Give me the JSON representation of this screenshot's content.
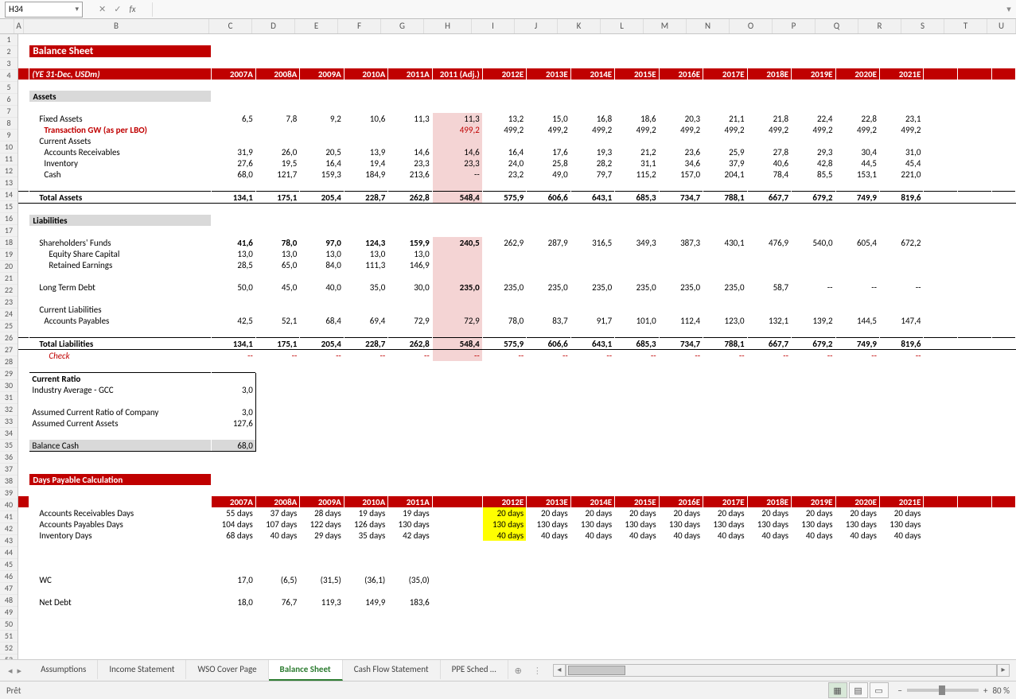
{
  "cellRef": "H34",
  "fxValue": "",
  "statusText": "Prêt",
  "zoomPct": "80 %",
  "cols": [
    "A",
    "B",
    "C",
    "D",
    "E",
    "F",
    "G",
    "H",
    "I",
    "J",
    "K",
    "L",
    "M",
    "N",
    "O",
    "P",
    "Q",
    "R",
    "S",
    "T",
    "U"
  ],
  "colWidths": {
    "A": 11,
    "B": 232,
    "C": 53,
    "D": 53,
    "E": 53,
    "F": 53,
    "G": 53,
    "H": 59,
    "I": 53,
    "J": 53,
    "K": 53,
    "L": 53,
    "M": 53,
    "N": 53,
    "O": 53,
    "P": 53,
    "Q": 53,
    "R": 53,
    "S": 53,
    "T": 53,
    "U": 35
  },
  "tabs": [
    "Assumptions",
    "Income Statement",
    "WSO Cover Page",
    "Balance Sheet",
    "Cash Flow Statement",
    "PPE Sched …"
  ],
  "activeTab": 3,
  "title": "Balance Sheet",
  "yearsLabel": "(YE 31-Dec, USDm)",
  "years": [
    "2007A",
    "2008A",
    "2009A",
    "2010A",
    "2011A",
    "2011 (Adj.)",
    "2012E",
    "2013E",
    "2014E",
    "2015E",
    "2016E",
    "2017E",
    "2018E",
    "2019E",
    "2020E",
    "2021E"
  ],
  "assetsHeader": "Assets",
  "liabHeader": "Liabilities",
  "dpHeader": "Days Payable Calculation",
  "rows": {
    "fixedAssets": {
      "label": "Fixed Assets",
      "v": [
        "6,5",
        "7,8",
        "9,2",
        "10,6",
        "11,3",
        "11,3",
        "13,2",
        "15,0",
        "16,8",
        "18,6",
        "20,3",
        "21,1",
        "21,8",
        "22,4",
        "22,8",
        "23,1"
      ]
    },
    "transGW": {
      "label": "Transaction GW (as per LBO)",
      "v": [
        "",
        "",
        "",
        "",
        "",
        "499,2",
        "499,2",
        "499,2",
        "499,2",
        "499,2",
        "499,2",
        "499,2",
        "499,2",
        "499,2",
        "499,2",
        "499,2"
      ]
    },
    "curAssetsLbl": "Current Assets",
    "ar": {
      "label": "Accounts Receivables",
      "v": [
        "31,9",
        "26,0",
        "20,5",
        "13,9",
        "14,6",
        "14,6",
        "16,4",
        "17,6",
        "19,3",
        "21,2",
        "23,6",
        "25,9",
        "27,8",
        "29,3",
        "30,4",
        "31,0"
      ]
    },
    "inv": {
      "label": "Inventory",
      "v": [
        "27,6",
        "19,5",
        "16,4",
        "19,4",
        "23,3",
        "23,3",
        "24,0",
        "25,8",
        "28,2",
        "31,1",
        "34,6",
        "37,9",
        "40,6",
        "42,8",
        "44,5",
        "45,4"
      ]
    },
    "cash": {
      "label": "Cash",
      "v": [
        "68,0",
        "121,7",
        "159,3",
        "184,9",
        "213,6",
        "--",
        "23,2",
        "49,0",
        "79,7",
        "115,2",
        "157,0",
        "204,1",
        "78,4",
        "85,5",
        "153,1",
        "221,0"
      ]
    },
    "totAssets": {
      "label": "Total Assets",
      "v": [
        "134,1",
        "175,1",
        "205,4",
        "228,7",
        "262,8",
        "548,4",
        "575,9",
        "606,6",
        "643,1",
        "685,3",
        "734,7",
        "788,1",
        "667,7",
        "679,2",
        "749,9",
        "819,6"
      ]
    },
    "shFunds": {
      "label": "Shareholders' Funds",
      "v": [
        "41,6",
        "78,0",
        "97,0",
        "124,3",
        "159,9",
        "240,5",
        "262,9",
        "287,9",
        "316,5",
        "349,3",
        "387,3",
        "430,1",
        "476,9",
        "540,0",
        "605,4",
        "672,2"
      ]
    },
    "esc": {
      "label": "Equity Share Capital",
      "v": [
        "13,0",
        "13,0",
        "13,0",
        "13,0",
        "13,0",
        "",
        "",
        "",
        "",
        "",
        "",
        "",
        "",
        "",
        "",
        ""
      ]
    },
    "re": {
      "label": "Retained Earnings",
      "v": [
        "28,5",
        "65,0",
        "84,0",
        "111,3",
        "146,9",
        "",
        "",
        "",
        "",
        "",
        "",
        "",
        "",
        "",
        "",
        ""
      ]
    },
    "ltd": {
      "label": "Long Term Debt",
      "v": [
        "50,0",
        "45,0",
        "40,0",
        "35,0",
        "30,0",
        "235,0",
        "235,0",
        "235,0",
        "235,0",
        "235,0",
        "235,0",
        "235,0",
        "58,7",
        "--",
        "--",
        "--"
      ]
    },
    "curLiabLbl": "Current Liabilities",
    "ap": {
      "label": "Accounts Payables",
      "v": [
        "42,5",
        "52,1",
        "68,4",
        "69,4",
        "72,9",
        "72,9",
        "78,0",
        "83,7",
        "91,7",
        "101,0",
        "112,4",
        "123,0",
        "132,1",
        "139,2",
        "144,5",
        "147,4"
      ]
    },
    "totLiab": {
      "label": "Total Liabilities",
      "v": [
        "134,1",
        "175,1",
        "205,4",
        "228,7",
        "262,8",
        "548,4",
        "575,9",
        "606,6",
        "643,1",
        "685,3",
        "734,7",
        "788,1",
        "667,7",
        "679,2",
        "749,9",
        "819,6"
      ]
    },
    "check": {
      "label": "Check",
      "v": [
        "--",
        "--",
        "--",
        "--",
        "--",
        "--",
        "--",
        "--",
        "--",
        "--",
        "--",
        "--",
        "--",
        "--",
        "--",
        "--"
      ]
    }
  },
  "crBox": {
    "title": "Current Ratio",
    "ind": {
      "label": "Industry Average - GCC",
      "v": "3,0"
    },
    "ass": {
      "label": "Assumed Current Ratio of Company",
      "v": "3,0"
    },
    "ca": {
      "label": "Assumed Current Assets",
      "v": "127,6"
    },
    "bal": {
      "label": "Balance Cash",
      "v": "68,0"
    }
  },
  "dp": {
    "yearsA": [
      "2007A",
      "2008A",
      "2009A",
      "2010A",
      "2011A"
    ],
    "yearsE": [
      "2012E",
      "2013E",
      "2014E",
      "2015E",
      "2016E",
      "2017E",
      "2018E",
      "2019E",
      "2020E",
      "2021E"
    ],
    "ard": {
      "label": "Accounts Receivables Days",
      "a": [
        "55 days",
        "37 days",
        "28 days",
        "19 days",
        "19 days"
      ],
      "e": [
        "20 days",
        "20 days",
        "20 days",
        "20 days",
        "20 days",
        "20 days",
        "20 days",
        "20 days",
        "20 days",
        "20 days"
      ]
    },
    "apd": {
      "label": "Accounts Payables Days",
      "a": [
        "104 days",
        "107 days",
        "122 days",
        "126 days",
        "130 days"
      ],
      "e": [
        "130 days",
        "130 days",
        "130 days",
        "130 days",
        "130 days",
        "130 days",
        "130 days",
        "130 days",
        "130 days",
        "130 days"
      ]
    },
    "invd": {
      "label": "Inventory Days",
      "a": [
        "68 days",
        "40 days",
        "29 days",
        "35 days",
        "42 days"
      ],
      "e": [
        "40 days",
        "40 days",
        "40 days",
        "40 days",
        "40 days",
        "40 days",
        "40 days",
        "40 days",
        "40 days",
        "40 days"
      ]
    }
  },
  "wc": {
    "label": "WC",
    "v": [
      "17,0",
      "(6,5)",
      "(31,5)",
      "(36,1)",
      "(35,0)"
    ]
  },
  "nd": {
    "label": "Net Debt",
    "v": [
      "18,0",
      "76,7",
      "119,3",
      "149,9",
      "183,6"
    ]
  }
}
